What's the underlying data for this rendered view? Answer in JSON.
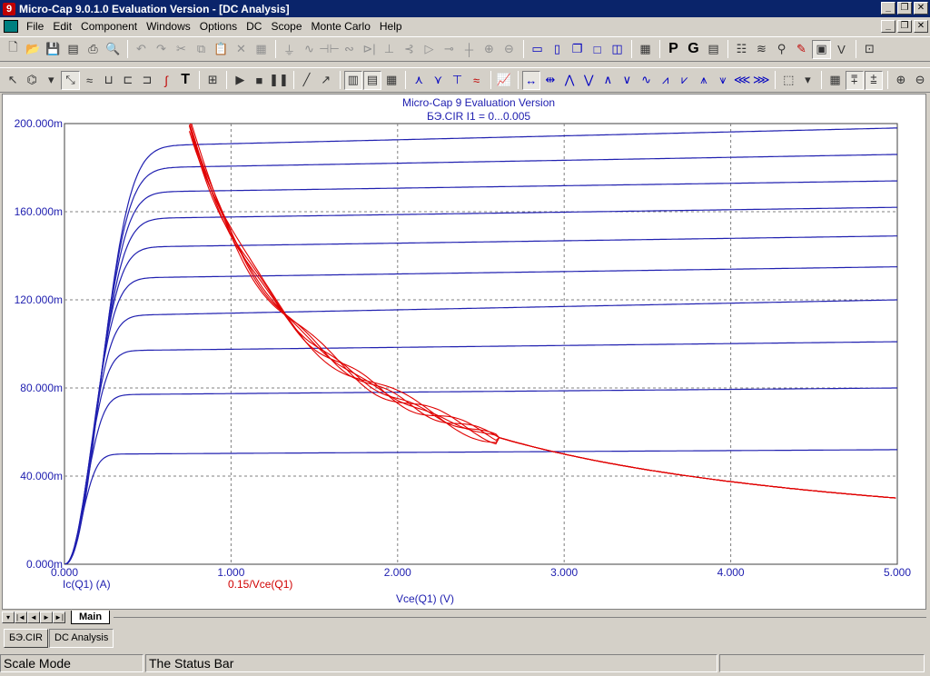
{
  "window": {
    "title": "Micro-Cap 9.0.1.0 Evaluation Version - [DC Analysis]",
    "app_icon": "9"
  },
  "menu": [
    "File",
    "Edit",
    "Component",
    "Windows",
    "Options",
    "DC",
    "Scope",
    "Monte Carlo",
    "Help"
  ],
  "plot": {
    "title_line1": "Micro-Cap 9 Evaluation Version",
    "title_line2": "БЭ.CIR I1 = 0...0.005",
    "y_ticks": [
      "200.000m",
      "160.000m",
      "120.000m",
      "80.000m",
      "40.000m",
      "0.000m"
    ],
    "x_ticks": [
      "0.000",
      "1.000",
      "2.000",
      "3.000",
      "4.000",
      "5.000"
    ],
    "legend_ic": "Ic(Q1) (A)",
    "legend_hyper": "0.15/Vce(Q1)",
    "xlabel": "Vce(Q1) (V)"
  },
  "chart_data": {
    "type": "line",
    "xlim": [
      0,
      5
    ],
    "ylim": [
      0,
      0.2
    ],
    "grid": true,
    "x_ticks": [
      0,
      1,
      2,
      3,
      4,
      5
    ],
    "y_ticks": [
      0,
      0.04,
      0.08,
      0.12,
      0.16,
      0.2
    ],
    "ic_family_saturation_A": [
      0.05,
      0.077,
      0.097,
      0.113,
      0.13,
      0.144,
      0.157,
      0.169,
      0.18,
      0.19
    ],
    "ic_family_at_5V_A": [
      0.052,
      0.08,
      0.101,
      0.12,
      0.135,
      0.149,
      0.162,
      0.174,
      0.186,
      0.198
    ],
    "ic_knee_V": [
      0.25,
      0.3,
      0.33,
      0.36,
      0.39,
      0.42,
      0.45,
      0.47,
      0.49,
      0.51
    ],
    "hyperbola": {
      "k": 0.15,
      "x_start": 0.75,
      "x_end": 5.0
    },
    "colors": {
      "ic": "#2020b0",
      "hyperbola": "#e00000"
    }
  },
  "tabs": {
    "nav": [
      "◄",
      "◄",
      "◄",
      "►",
      "►"
    ],
    "main_tab": "Main"
  },
  "doc_tabs": [
    "БЭ.CIR",
    "DC Analysis"
  ],
  "status": {
    "mode": "Scale Mode",
    "text": "The Status Bar"
  },
  "toolbar2_text_buttons": {
    "p_button": "P",
    "g_button": "G",
    "t_button": "T"
  }
}
